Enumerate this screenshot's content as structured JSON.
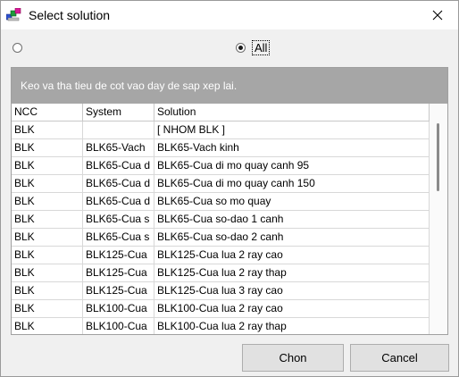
{
  "window": {
    "title": "Select solution",
    "accent": "#0078d7"
  },
  "filters": {
    "option_left_label": "",
    "option_all_label": "All",
    "selected": "all"
  },
  "grid": {
    "group_hint": "Keo va tha tieu de cot vao day de sap xep lai.",
    "columns": [
      "NCC",
      "System",
      "Solution"
    ],
    "rows": [
      [
        "BLK",
        "",
        "[ NHOM BLK ]"
      ],
      [
        "BLK",
        "BLK65-Vach",
        "BLK65-Vach kinh"
      ],
      [
        "BLK",
        "BLK65-Cua d",
        "BLK65-Cua di mo quay canh 95"
      ],
      [
        "BLK",
        "BLK65-Cua d",
        "BLK65-Cua di mo quay canh 150"
      ],
      [
        "BLK",
        "BLK65-Cua d",
        "BLK65-Cua so mo quay"
      ],
      [
        "BLK",
        "BLK65-Cua s",
        "BLK65-Cua so-dao 1 canh"
      ],
      [
        "BLK",
        "BLK65-Cua s",
        "BLK65-Cua so-dao 2 canh"
      ],
      [
        "BLK",
        "BLK125-Cua",
        "BLK125-Cua lua 2 ray cao"
      ],
      [
        "BLK",
        "BLK125-Cua",
        "BLK125-Cua lua 2 ray thap"
      ],
      [
        "BLK",
        "BLK125-Cua",
        "BLK125-Cua lua 3 ray cao"
      ],
      [
        "BLK",
        "BLK100-Cua",
        "BLK100-Cua lua 2 ray cao"
      ],
      [
        "BLK",
        "BLK100-Cua",
        "BLK100-Cua lua 2 ray thap"
      ]
    ]
  },
  "buttons": {
    "choose": "Chon",
    "cancel": "Cancel"
  }
}
